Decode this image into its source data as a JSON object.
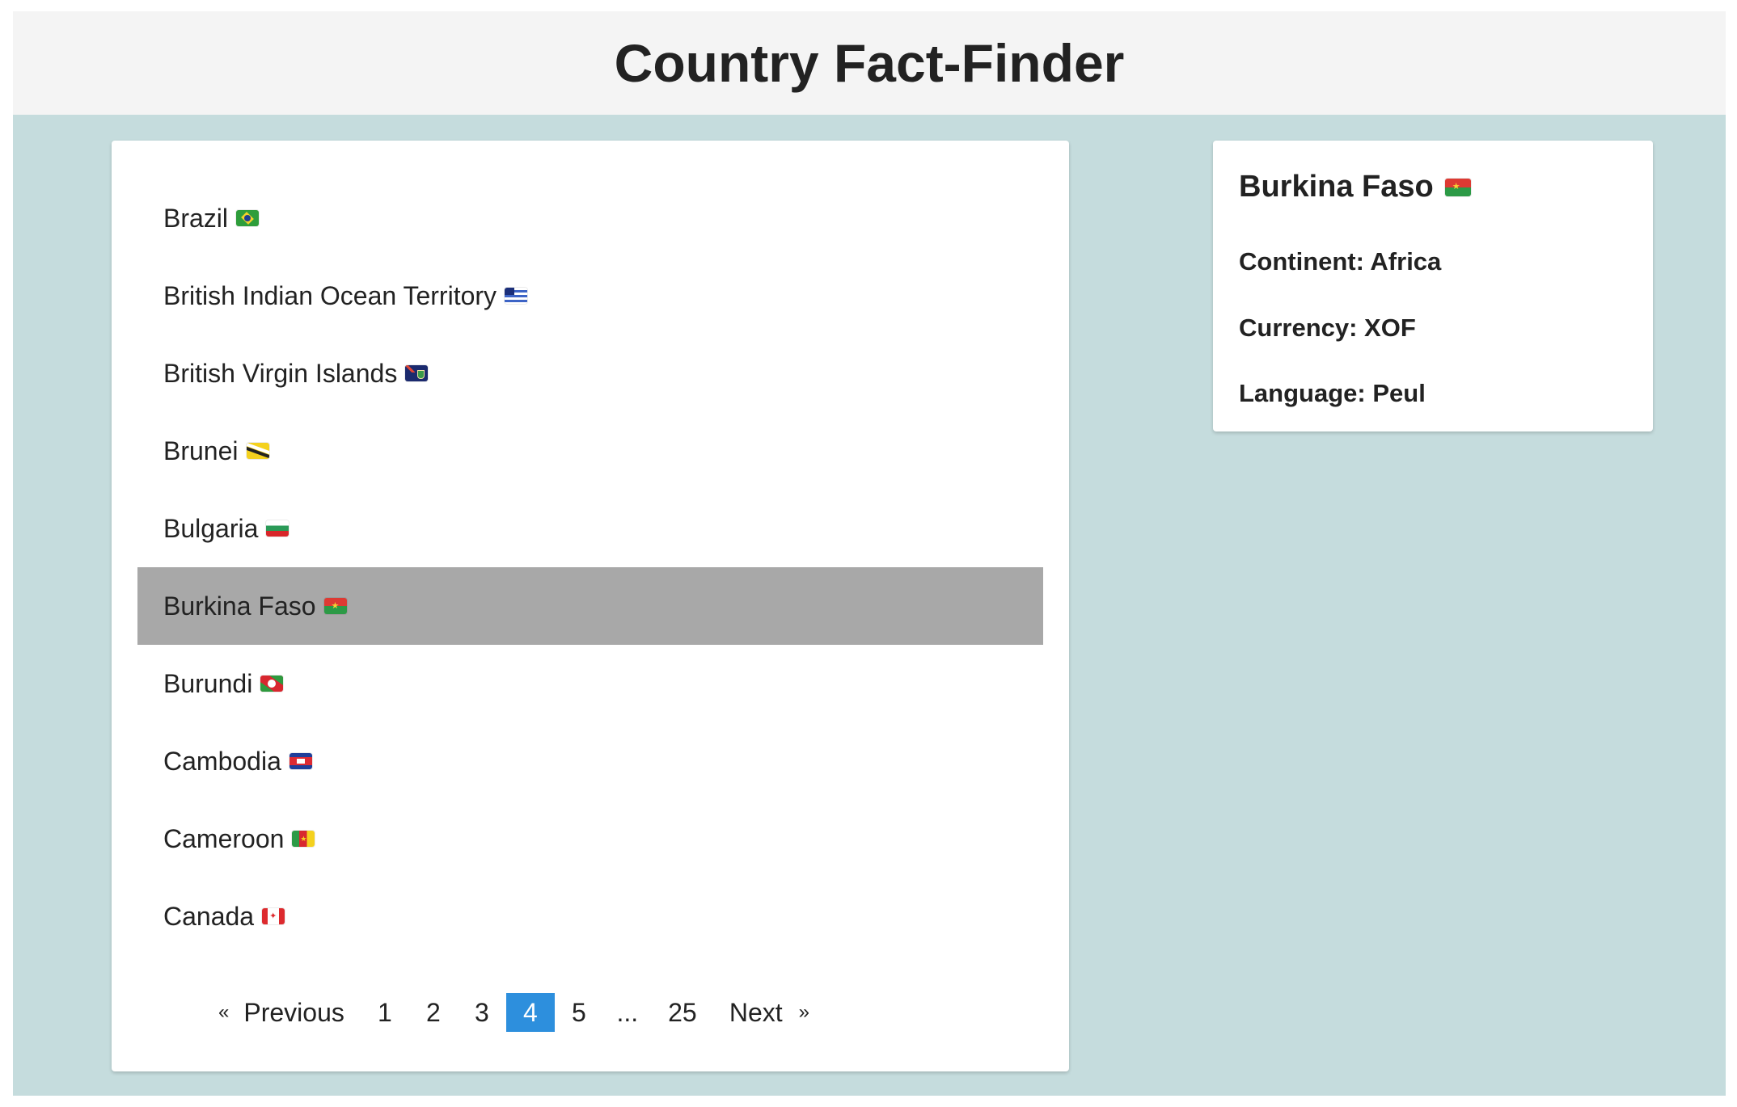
{
  "app": {
    "title": "Country Fact-Finder"
  },
  "countries": [
    {
      "name": "Brazil",
      "flag": "flag-brazil-icon",
      "selected": false
    },
    {
      "name": "British Indian Ocean Territory",
      "flag": "flag-british-indian-ocean-territory-icon",
      "selected": false
    },
    {
      "name": "British Virgin Islands",
      "flag": "flag-british-virgin-islands-icon",
      "selected": false
    },
    {
      "name": "Brunei",
      "flag": "flag-brunei-icon",
      "selected": false
    },
    {
      "name": "Bulgaria",
      "flag": "flag-bulgaria-icon",
      "selected": false
    },
    {
      "name": "Burkina Faso",
      "flag": "flag-burkina-faso-icon",
      "selected": true
    },
    {
      "name": "Burundi",
      "flag": "flag-burundi-icon",
      "selected": false
    },
    {
      "name": "Cambodia",
      "flag": "flag-cambodia-icon",
      "selected": false
    },
    {
      "name": "Cameroon",
      "flag": "flag-cameroon-icon",
      "selected": false
    },
    {
      "name": "Canada",
      "flag": "flag-canada-icon",
      "selected": false
    }
  ],
  "pagination": {
    "prev_arrow": "«",
    "prev_label": "Previous",
    "pages": [
      "1",
      "2",
      "3",
      "4",
      "5"
    ],
    "current_page": "4",
    "ellipsis": "...",
    "last_page": "25",
    "next_label": "Next",
    "next_arrow": "»",
    "active_color": "#2d8fdd"
  },
  "details": {
    "name": "Burkina Faso",
    "flag": "flag-burkina-faso-icon",
    "continent": "Continent: Africa",
    "currency": "Currency: XOF",
    "language": "Language: Peul"
  },
  "colors": {
    "background": "#c5dcdd",
    "header": "#f4f4f4",
    "selected_row": "#a8a8a8"
  }
}
